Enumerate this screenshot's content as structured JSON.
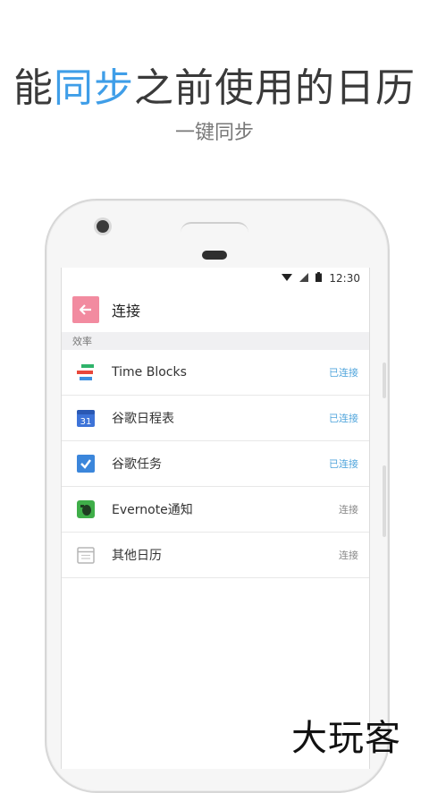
{
  "promo": {
    "headline_pre": "能",
    "headline_highlight": "同步",
    "headline_post": "之前使用的日历",
    "subline": "一键同步",
    "highlight_color": "#3f9ee8"
  },
  "status_bar": {
    "time": "12:30"
  },
  "app_bar": {
    "title": "连接",
    "back_color": "#f28ba0"
  },
  "section": {
    "label": "效率"
  },
  "rows": [
    {
      "icon": "time-blocks-icon",
      "label": "Time Blocks",
      "status": "已连接",
      "connected": true
    },
    {
      "icon": "google-calendar-icon",
      "label": "谷歌日程表",
      "status": "已连接",
      "connected": true,
      "icon_text": "31"
    },
    {
      "icon": "google-tasks-icon",
      "label": "谷歌任务",
      "status": "已连接",
      "connected": true
    },
    {
      "icon": "evernote-icon",
      "label": "Evernote通知",
      "status": "连接",
      "connected": false
    },
    {
      "icon": "other-calendar-icon",
      "label": "其他日历",
      "status": "连接",
      "connected": false
    }
  ],
  "watermark": "大玩客"
}
